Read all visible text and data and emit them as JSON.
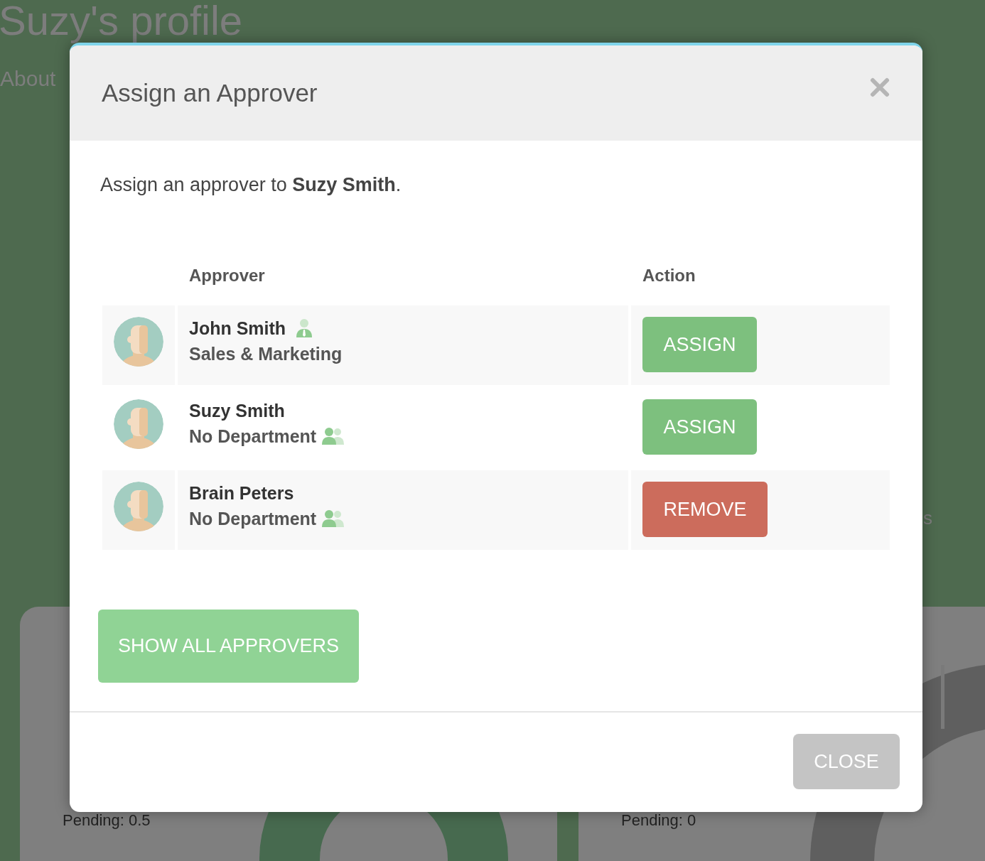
{
  "background_page": {
    "title": "Suzy's profile",
    "nav": [
      "About"
    ],
    "side_fragment": "s",
    "cards": [
      {
        "lines": [
          "Pending: 0.5"
        ]
      },
      {
        "lines": [
          "Pending: 0"
        ]
      }
    ]
  },
  "modal": {
    "title": "Assign an Approver",
    "intro": "Assign an approver to **Suzy Smith**.",
    "columns": [
      "Approver",
      "Action"
    ],
    "rows": [
      {
        "name": "John Smith",
        "department": "Sales & Marketing",
        "kind": "manager",
        "action": {
          "label": "ASSIGN",
          "kind": "assign"
        }
      },
      {
        "name": "Suzy Smith",
        "department": "No Department",
        "kind": "member",
        "action": {
          "label": "ASSIGN",
          "kind": "assign"
        }
      },
      {
        "name": "Brain Peters",
        "department": "No Department",
        "kind": "member",
        "action": {
          "label": "REMOVE",
          "kind": "remove"
        }
      }
    ],
    "show_all_button": "SHOW ALL APPROVERS",
    "close_button": "CLOSE"
  }
}
